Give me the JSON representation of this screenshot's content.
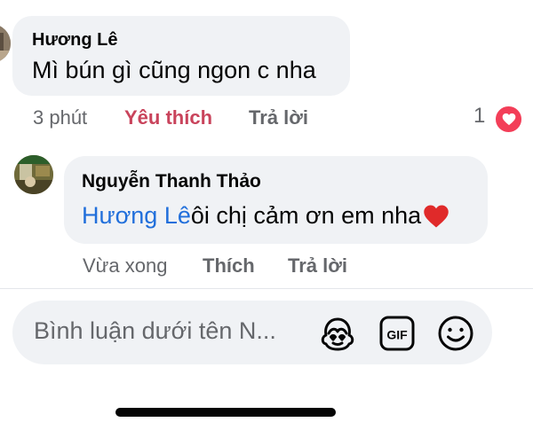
{
  "comments": [
    {
      "author": "Hương Lê",
      "text": "Mì bún gì cũng ngon c nha",
      "time": "3 phút",
      "like_label": "Yêu thích",
      "reply_label": "Trả lời",
      "reaction_count": "1",
      "reaction_icon": "heart-icon",
      "like_color": "#c9445c"
    },
    {
      "author": "Nguyễn Thanh Thảo",
      "mention": "Hương Lê",
      "text": " ôi chị cảm ơn em nha",
      "emoji": "heart-emoji",
      "time": "Vừa xong",
      "like_label": "Thích",
      "reply_label": "Trả lời",
      "mention_color": "#216fdb"
    }
  ],
  "composer": {
    "placeholder": "Bình luận dưới tên N...",
    "icons": [
      "avatar-sticker-icon",
      "gif-icon",
      "emoji-icon"
    ],
    "gif_label": "GIF"
  },
  "colors": {
    "bubble": "#f0f2f5",
    "meta_text": "#65676b",
    "reaction_heart": "#f33e58"
  }
}
